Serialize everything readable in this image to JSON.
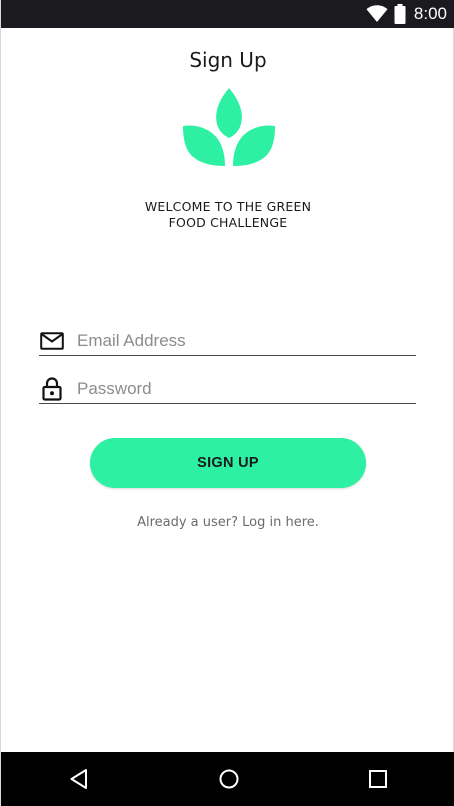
{
  "status_bar": {
    "time": "8:00",
    "icons": [
      "wifi-icon",
      "battery-icon"
    ]
  },
  "screen": {
    "title": "Sign Up",
    "logo_icon": "leaf-logo-icon",
    "welcome_line1": "WELCOME TO THE GREEN",
    "welcome_line2": "FOOD CHALLENGE"
  },
  "form": {
    "email": {
      "placeholder": "Email Address",
      "value": "",
      "icon": "mail-icon"
    },
    "password": {
      "placeholder": "Password",
      "value": "",
      "icon": "lock-icon"
    },
    "submit_label": "SIGN UP",
    "login_link": "Already a user? Log in here."
  },
  "nav_bar": {
    "buttons": [
      "back-icon",
      "home-icon",
      "recents-icon"
    ]
  },
  "colors": {
    "accent": "#2ef0a2",
    "status_bar": "#1b1b1f",
    "nav_bar": "#000000"
  }
}
